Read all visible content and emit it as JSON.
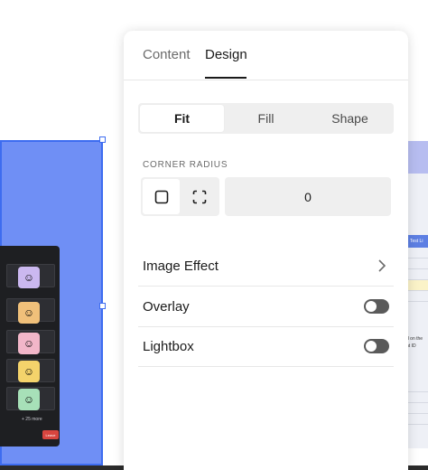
{
  "panel": {
    "tabs": [
      {
        "label": "Content",
        "active": false
      },
      {
        "label": "Design",
        "active": true
      }
    ],
    "fit_modes": [
      {
        "label": "Fit",
        "active": true
      },
      {
        "label": "Fill",
        "active": false
      },
      {
        "label": "Shape",
        "active": false
      }
    ],
    "corner_radius": {
      "label": "CORNER RADIUS",
      "value": "0",
      "options": [
        {
          "icon": "square-corners-icon",
          "active": true
        },
        {
          "icon": "independent-corners-icon",
          "active": false
        }
      ]
    },
    "image_effect": {
      "label": "Image Effect",
      "icon": "chevron-right-icon"
    },
    "overlay": {
      "label": "Overlay",
      "on": false
    },
    "lightbox": {
      "label": "Lightbox",
      "on": false
    }
  },
  "canvas": {
    "participant_list_more": "+ 25 more",
    "leave_button": "Leave",
    "right_table_header": "Test Li",
    "right_text_1": "d on the",
    "right_text_2": "nt ID"
  },
  "colors": {
    "selection_blue": "#3d6cf0",
    "image_bg": "#6f8ff5",
    "toggle_off": "#5a5a5a",
    "panel_bg": "#ffffff",
    "segment_bg": "#efefef"
  }
}
